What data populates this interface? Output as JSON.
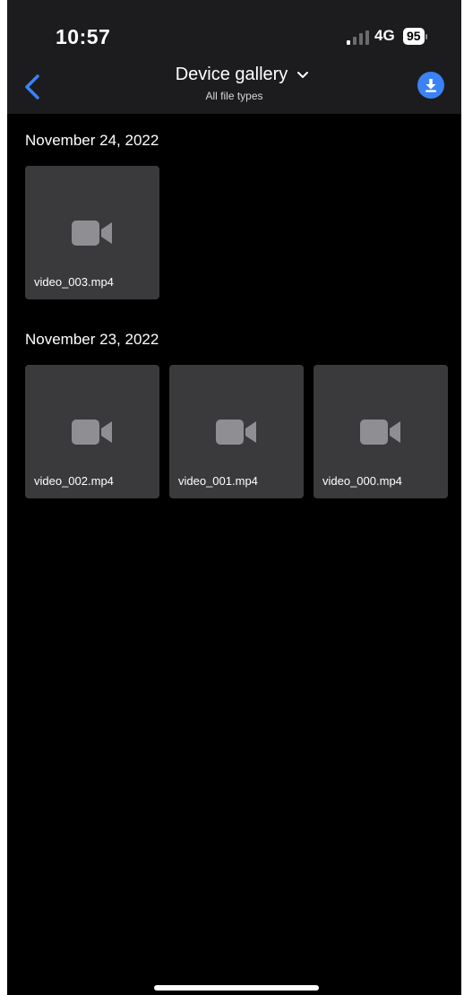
{
  "status_bar": {
    "time": "10:57",
    "network": "4G",
    "battery": "95"
  },
  "nav": {
    "title": "Device gallery",
    "subtitle": "All file types",
    "icons": {
      "back": "chevron-left-icon",
      "title_dropdown": "chevron-down-icon",
      "download": "download-icon"
    },
    "accent_color": "#3b82f6"
  },
  "sections": [
    {
      "date": "November 24, 2022",
      "items": [
        {
          "name": "video_003.mp4",
          "icon": "video-camera-icon"
        }
      ]
    },
    {
      "date": "November 23, 2022",
      "items": [
        {
          "name": "video_002.mp4",
          "icon": "video-camera-icon"
        },
        {
          "name": "video_001.mp4",
          "icon": "video-camera-icon"
        },
        {
          "name": "video_000.mp4",
          "icon": "video-camera-icon"
        }
      ]
    }
  ]
}
